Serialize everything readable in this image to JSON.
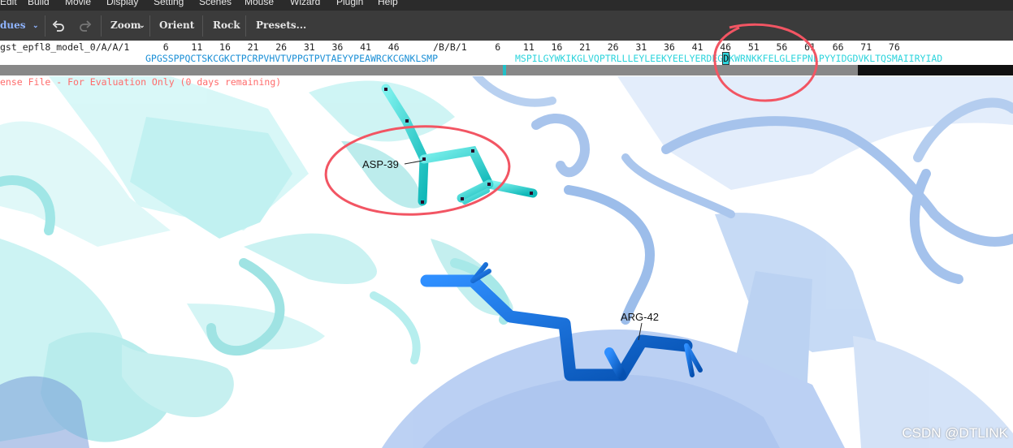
{
  "menu": [
    "Edit",
    "Build",
    "Movie",
    "Display",
    "Setting",
    "Scenes",
    "Mouse",
    "Wizard",
    "Plugin",
    "Help"
  ],
  "toolbar": {
    "selection_mode": "dues",
    "zoom_label": "Zoom",
    "orient_label": "Orient",
    "rock_label": "Rock",
    "presets_label": "Presets..."
  },
  "sequence": {
    "numbers_line": "gst_epfl8_model_0/A/A/1      6    11   16   21   26   31   36   41   46      /B/B/1     6    11   16   21   26   31   36   41   46   51   56   61   66   71   76",
    "chain_a": "GPGSSPPQCTSKCGKCTPCRPVHVTVPPGTPVTAEYYPEAWRCKCGNKLSMP",
    "chain_b_pre": "MSPILGYWKIKGLVQPTRLLLEYLEEKYEELYERDEG",
    "chain_b_selected": "D",
    "chain_b_post": "KWRNKKFELGLEFPNLPYYIDGDVKLTQSMAIIRYIAD"
  },
  "license_notice": "ense File - For Evaluation Only (0 days remaining)",
  "residue_labels": {
    "asp": "ASP-39",
    "arg": "ARG-42"
  },
  "watermark": "CSDN @DTLINK",
  "colors": {
    "chain_a": "#1a8fd6",
    "chain_b": "#2dd4dc",
    "asp_stick": "#1ad6d0",
    "arg_stick": "#0a6fd8",
    "annotation_circle": "#f25563",
    "license_text": "#ff6b6b"
  }
}
